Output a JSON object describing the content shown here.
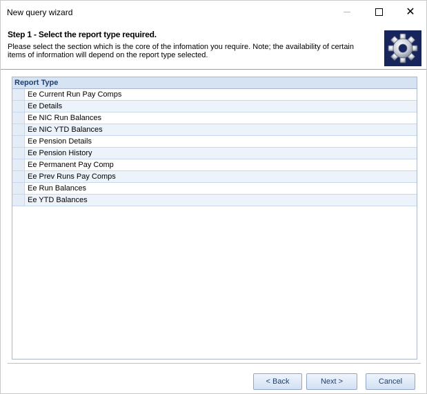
{
  "window": {
    "title": "New query wizard"
  },
  "header": {
    "step_title": "Step 1 - Select the report type required.",
    "description": "Please select the section which is the core of the infomation you require. Note; the availability of certain items of information will depend on the report type selected.",
    "icon": "gear-icon",
    "icon_bg_color": "#16255c"
  },
  "grid": {
    "column_header": "Report Type",
    "rows": [
      "Ee Current Run Pay Comps",
      "Ee Details",
      "Ee NIC Run Balances",
      "Ee NIC YTD Balances",
      "Ee Pension Details",
      "Ee Pension History",
      "Ee Permanent Pay Comp",
      "Ee Prev Runs Pay Comps",
      "Ee Run Balances",
      "Ee YTD Balances"
    ]
  },
  "footer": {
    "back_label": "< Back",
    "next_label": "Next >",
    "cancel_label": "Cancel"
  }
}
